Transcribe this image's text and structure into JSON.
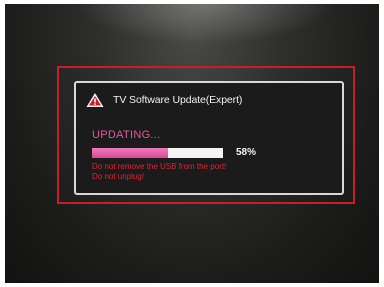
{
  "dialog": {
    "title": "TV Software Update(Expert)",
    "status": "UPDATING...",
    "progress": {
      "fraction": 0.58,
      "label": "58%"
    },
    "warnings": [
      "Do not remove the USB from the port!",
      "Do not unplug!"
    ],
    "icon": "warning-triangle-icon"
  },
  "colors": {
    "frame": "#c81e2a",
    "status_text": "#e35aa0",
    "progress_fill": "#e35aa0",
    "warning_text": "#e0232f"
  }
}
